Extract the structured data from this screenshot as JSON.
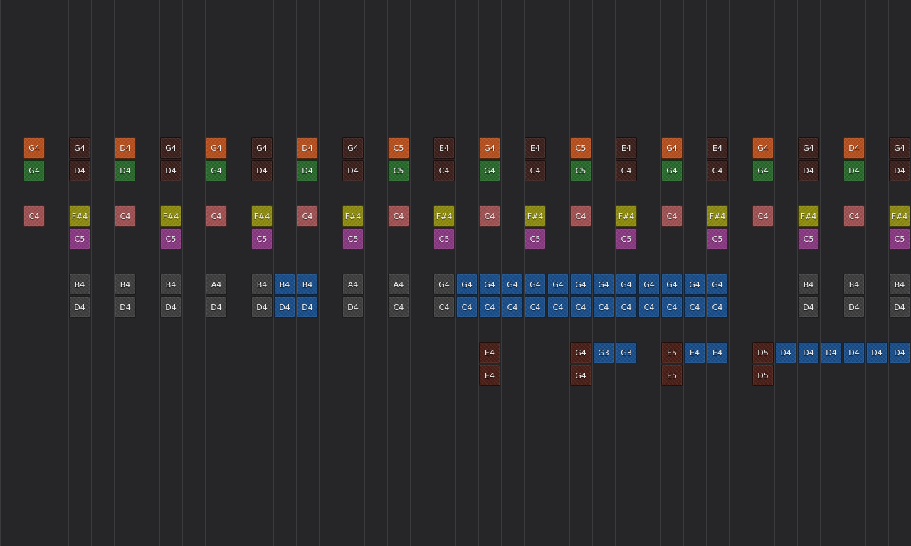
{
  "palette": {
    "orange": "#b9511f",
    "green": "#2a6b2d",
    "maroon": "#3c211d",
    "pink": "#a15354",
    "yellow": "#8f8d10",
    "purple": "#8a3a82",
    "gray": "#3f3f40",
    "blue": "#1a4f8c",
    "brick": "#4a2018"
  },
  "rows": [
    {
      "id": "row1",
      "notes": [
        {
          "col": 1,
          "label": "G4",
          "color": "orange"
        },
        {
          "col": 3,
          "label": "G4",
          "color": "maroon"
        },
        {
          "col": 5,
          "label": "D4",
          "color": "orange"
        },
        {
          "col": 7,
          "label": "G4",
          "color": "maroon"
        },
        {
          "col": 9,
          "label": "G4",
          "color": "orange"
        },
        {
          "col": 11,
          "label": "G4",
          "color": "maroon"
        },
        {
          "col": 13,
          "label": "D4",
          "color": "orange"
        },
        {
          "col": 15,
          "label": "G4",
          "color": "maroon"
        },
        {
          "col": 17,
          "label": "C5",
          "color": "orange"
        },
        {
          "col": 19,
          "label": "E4",
          "color": "maroon"
        },
        {
          "col": 21,
          "label": "G4",
          "color": "orange"
        },
        {
          "col": 23,
          "label": "E4",
          "color": "maroon"
        },
        {
          "col": 25,
          "label": "C5",
          "color": "orange"
        },
        {
          "col": 27,
          "label": "E4",
          "color": "maroon"
        },
        {
          "col": 29,
          "label": "G4",
          "color": "orange"
        },
        {
          "col": 31,
          "label": "E4",
          "color": "maroon"
        },
        {
          "col": 33,
          "label": "G4",
          "color": "orange"
        },
        {
          "col": 35,
          "label": "G4",
          "color": "maroon"
        },
        {
          "col": 37,
          "label": "D4",
          "color": "orange"
        },
        {
          "col": 39,
          "label": "G4",
          "color": "maroon"
        }
      ]
    },
    {
      "id": "row2",
      "notes": [
        {
          "col": 1,
          "label": "G4",
          "color": "green"
        },
        {
          "col": 3,
          "label": "D4",
          "color": "maroon"
        },
        {
          "col": 5,
          "label": "D4",
          "color": "green"
        },
        {
          "col": 7,
          "label": "D4",
          "color": "maroon"
        },
        {
          "col": 9,
          "label": "G4",
          "color": "green"
        },
        {
          "col": 11,
          "label": "D4",
          "color": "maroon"
        },
        {
          "col": 13,
          "label": "D4",
          "color": "green"
        },
        {
          "col": 15,
          "label": "D4",
          "color": "maroon"
        },
        {
          "col": 17,
          "label": "C5",
          "color": "green"
        },
        {
          "col": 19,
          "label": "C4",
          "color": "maroon"
        },
        {
          "col": 21,
          "label": "G4",
          "color": "green"
        },
        {
          "col": 23,
          "label": "C4",
          "color": "maroon"
        },
        {
          "col": 25,
          "label": "C5",
          "color": "green"
        },
        {
          "col": 27,
          "label": "C4",
          "color": "maroon"
        },
        {
          "col": 29,
          "label": "G4",
          "color": "green"
        },
        {
          "col": 31,
          "label": "C4",
          "color": "maroon"
        },
        {
          "col": 33,
          "label": "G4",
          "color": "green"
        },
        {
          "col": 35,
          "label": "D4",
          "color": "maroon"
        },
        {
          "col": 37,
          "label": "D4",
          "color": "green"
        },
        {
          "col": 39,
          "label": "D4",
          "color": "maroon"
        }
      ]
    },
    {
      "id": "row3",
      "notes": [
        {
          "col": 1,
          "label": "C4",
          "color": "pink"
        },
        {
          "col": 3,
          "label": "F#4",
          "color": "yellow"
        },
        {
          "col": 5,
          "label": "C4",
          "color": "pink"
        },
        {
          "col": 7,
          "label": "F#4",
          "color": "yellow"
        },
        {
          "col": 9,
          "label": "C4",
          "color": "pink"
        },
        {
          "col": 11,
          "label": "F#4",
          "color": "yellow"
        },
        {
          "col": 13,
          "label": "C4",
          "color": "pink"
        },
        {
          "col": 15,
          "label": "F#4",
          "color": "yellow"
        },
        {
          "col": 17,
          "label": "C4",
          "color": "pink"
        },
        {
          "col": 19,
          "label": "F#4",
          "color": "yellow"
        },
        {
          "col": 21,
          "label": "C4",
          "color": "pink"
        },
        {
          "col": 23,
          "label": "F#4",
          "color": "yellow"
        },
        {
          "col": 25,
          "label": "C4",
          "color": "pink"
        },
        {
          "col": 27,
          "label": "F#4",
          "color": "yellow"
        },
        {
          "col": 29,
          "label": "C4",
          "color": "pink"
        },
        {
          "col": 31,
          "label": "F#4",
          "color": "yellow"
        },
        {
          "col": 33,
          "label": "C4",
          "color": "pink"
        },
        {
          "col": 35,
          "label": "F#4",
          "color": "yellow"
        },
        {
          "col": 37,
          "label": "C4",
          "color": "pink"
        },
        {
          "col": 39,
          "label": "F#4",
          "color": "yellow"
        }
      ]
    },
    {
      "id": "row4",
      "notes": [
        {
          "col": 3,
          "label": "C5",
          "color": "purple"
        },
        {
          "col": 7,
          "label": "C5",
          "color": "purple"
        },
        {
          "col": 11,
          "label": "C5",
          "color": "purple"
        },
        {
          "col": 15,
          "label": "C5",
          "color": "purple"
        },
        {
          "col": 19,
          "label": "C5",
          "color": "purple"
        },
        {
          "col": 23,
          "label": "C5",
          "color": "purple"
        },
        {
          "col": 27,
          "label": "C5",
          "color": "purple"
        },
        {
          "col": 31,
          "label": "C5",
          "color": "purple"
        },
        {
          "col": 35,
          "label": "C5",
          "color": "purple"
        },
        {
          "col": 39,
          "label": "C5",
          "color": "purple"
        }
      ]
    },
    {
      "id": "row5",
      "notes": [
        {
          "col": 3,
          "label": "B4",
          "color": "gray"
        },
        {
          "col": 5,
          "label": "B4",
          "color": "gray"
        },
        {
          "col": 7,
          "label": "B4",
          "color": "gray"
        },
        {
          "col": 9,
          "label": "A4",
          "color": "gray"
        },
        {
          "col": 11,
          "label": "B4",
          "color": "gray"
        },
        {
          "col": 12,
          "label": "B4",
          "color": "blue"
        },
        {
          "col": 13,
          "label": "B4",
          "color": "blue"
        },
        {
          "col": 15,
          "label": "A4",
          "color": "gray"
        },
        {
          "col": 17,
          "label": "A4",
          "color": "gray"
        },
        {
          "col": 19,
          "label": "G4",
          "color": "gray"
        },
        {
          "col": 20,
          "label": "G4",
          "color": "blue"
        },
        {
          "col": 21,
          "label": "G4",
          "color": "blue"
        },
        {
          "col": 22,
          "label": "G4",
          "color": "blue"
        },
        {
          "col": 23,
          "label": "G4",
          "color": "blue"
        },
        {
          "col": 24,
          "label": "G4",
          "color": "blue"
        },
        {
          "col": 25,
          "label": "G4",
          "color": "blue"
        },
        {
          "col": 26,
          "label": "G4",
          "color": "blue"
        },
        {
          "col": 27,
          "label": "G4",
          "color": "blue"
        },
        {
          "col": 28,
          "label": "G4",
          "color": "blue"
        },
        {
          "col": 29,
          "label": "G4",
          "color": "blue"
        },
        {
          "col": 30,
          "label": "G4",
          "color": "blue"
        },
        {
          "col": 31,
          "label": "G4",
          "color": "blue"
        },
        {
          "col": 35,
          "label": "B4",
          "color": "gray"
        },
        {
          "col": 37,
          "label": "B4",
          "color": "gray"
        },
        {
          "col": 39,
          "label": "B4",
          "color": "gray"
        }
      ]
    },
    {
      "id": "row6",
      "notes": [
        {
          "col": 3,
          "label": "D4",
          "color": "gray"
        },
        {
          "col": 5,
          "label": "D4",
          "color": "gray"
        },
        {
          "col": 7,
          "label": "D4",
          "color": "gray"
        },
        {
          "col": 9,
          "label": "D4",
          "color": "gray"
        },
        {
          "col": 11,
          "label": "D4",
          "color": "gray"
        },
        {
          "col": 12,
          "label": "D4",
          "color": "blue"
        },
        {
          "col": 13,
          "label": "D4",
          "color": "blue"
        },
        {
          "col": 15,
          "label": "D4",
          "color": "gray"
        },
        {
          "col": 17,
          "label": "C4",
          "color": "gray"
        },
        {
          "col": 19,
          "label": "C4",
          "color": "gray"
        },
        {
          "col": 20,
          "label": "C4",
          "color": "blue"
        },
        {
          "col": 21,
          "label": "C4",
          "color": "blue"
        },
        {
          "col": 22,
          "label": "C4",
          "color": "blue"
        },
        {
          "col": 23,
          "label": "C4",
          "color": "blue"
        },
        {
          "col": 24,
          "label": "C4",
          "color": "blue"
        },
        {
          "col": 25,
          "label": "C4",
          "color": "blue"
        },
        {
          "col": 26,
          "label": "C4",
          "color": "blue"
        },
        {
          "col": 27,
          "label": "C4",
          "color": "blue"
        },
        {
          "col": 28,
          "label": "C4",
          "color": "blue"
        },
        {
          "col": 29,
          "label": "C4",
          "color": "blue"
        },
        {
          "col": 30,
          "label": "C4",
          "color": "blue"
        },
        {
          "col": 31,
          "label": "C4",
          "color": "blue"
        },
        {
          "col": 35,
          "label": "D4",
          "color": "gray"
        },
        {
          "col": 37,
          "label": "D4",
          "color": "gray"
        },
        {
          "col": 39,
          "label": "D4",
          "color": "gray"
        }
      ]
    },
    {
      "id": "row7",
      "notes": [
        {
          "col": 21,
          "label": "E4",
          "color": "brick"
        },
        {
          "col": 25,
          "label": "G4",
          "color": "brick"
        },
        {
          "col": 26,
          "label": "G3",
          "color": "blue"
        },
        {
          "col": 27,
          "label": "G3",
          "color": "blue"
        },
        {
          "col": 29,
          "label": "E5",
          "color": "brick"
        },
        {
          "col": 30,
          "label": "E4",
          "color": "blue"
        },
        {
          "col": 31,
          "label": "E4",
          "color": "blue"
        },
        {
          "col": 33,
          "label": "D5",
          "color": "brick"
        },
        {
          "col": 34,
          "label": "D4",
          "color": "blue"
        },
        {
          "col": 35,
          "label": "D4",
          "color": "blue"
        },
        {
          "col": 36,
          "label": "D4",
          "color": "blue"
        },
        {
          "col": 37,
          "label": "D4",
          "color": "blue"
        },
        {
          "col": 38,
          "label": "D4",
          "color": "blue"
        },
        {
          "col": 39,
          "label": "D4",
          "color": "blue"
        }
      ]
    },
    {
      "id": "row8",
      "notes": [
        {
          "col": 21,
          "label": "E4",
          "color": "brick"
        },
        {
          "col": 25,
          "label": "G4",
          "color": "brick"
        },
        {
          "col": 29,
          "label": "E5",
          "color": "brick"
        },
        {
          "col": 33,
          "label": "D5",
          "color": "brick"
        }
      ]
    }
  ]
}
